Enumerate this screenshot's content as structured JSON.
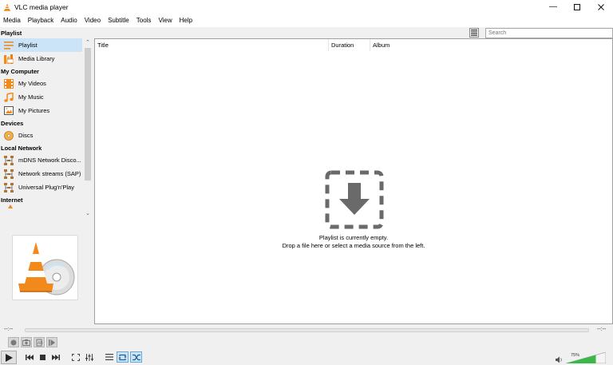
{
  "window": {
    "title": "VLC media player",
    "controls": [
      "minimize",
      "maximize",
      "close"
    ]
  },
  "menu": [
    "Media",
    "Playback",
    "Audio",
    "Video",
    "Subtitle",
    "Tools",
    "View",
    "Help"
  ],
  "sidebar": {
    "sections": [
      {
        "header": "Playlist",
        "items": [
          {
            "label": "Playlist",
            "icon": "playlist-icon",
            "selected": true
          },
          {
            "label": "Media Library",
            "icon": "media-library-icon"
          }
        ]
      },
      {
        "header": "My Computer",
        "items": [
          {
            "label": "My Videos",
            "icon": "videos-icon"
          },
          {
            "label": "My Music",
            "icon": "music-icon"
          },
          {
            "label": "My Pictures",
            "icon": "pictures-icon"
          }
        ]
      },
      {
        "header": "Devices",
        "items": [
          {
            "label": "Discs",
            "icon": "disc-icon"
          }
        ]
      },
      {
        "header": "Local Network",
        "items": [
          {
            "label": "mDNS Network Disco...",
            "icon": "network-icon"
          },
          {
            "label": "Network streams (SAP)",
            "icon": "network-icon"
          },
          {
            "label": "Universal Plug'n'Play",
            "icon": "network-icon"
          }
        ]
      },
      {
        "header": "Internet",
        "items": []
      }
    ]
  },
  "playlist": {
    "search_placeholder": "Search",
    "columns": [
      "Title",
      "Duration",
      "Album"
    ],
    "empty_line1": "Playlist is currently empty.",
    "empty_line2": "Drop a file here or select a media source from the left."
  },
  "player": {
    "elapsed": "--:--",
    "remaining": "--:--",
    "volume_label": "75%",
    "volume_level": 0.75,
    "colors": {
      "accent": "#3daee9",
      "volume_fill": "#3cb84a",
      "vlc_orange": "#f28a1b"
    }
  }
}
